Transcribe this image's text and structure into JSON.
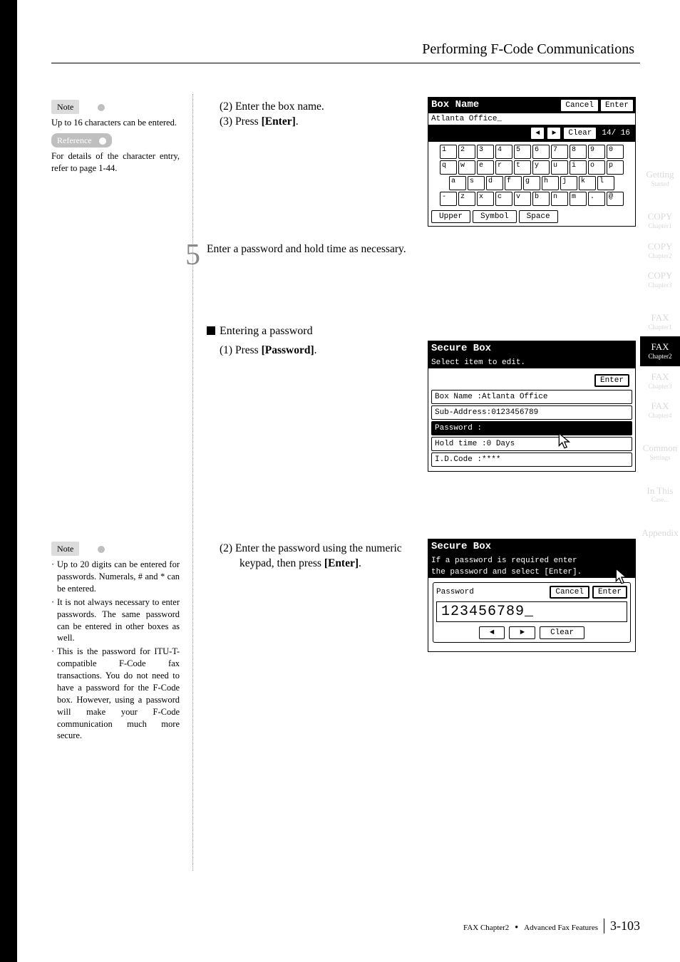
{
  "header": {
    "title": "Performing F-Code Communications"
  },
  "sidebar_note1": {
    "pill": "Note",
    "body": "Up to 16 characters can be entered.",
    "ref_pill": "Reference",
    "ref_body": "For details of the character entry, refer to page 1-44."
  },
  "sidebar_note2": {
    "pill": "Note",
    "b1": "Up to 20 digits can be entered for passwords. Numerals, # and * can be entered.",
    "b2": "It is not always necessary to enter passwords. The same password can be entered in other boxes as well.",
    "b3": "This is the password for ITU-T-compatible F-Code fax transactions. You do not need to have a password for the F-Code box. However, using a password will make your F-Code communication much more secure."
  },
  "main": {
    "m1a": "(2) Enter the box name.",
    "m1b_pre": "(3) Press ",
    "m1b_bold": "[Enter]",
    "m1b_post": ".",
    "step5_num": "5",
    "step5_text": "Enter a password and hold time as necessary.",
    "m3_head": "Entering a password",
    "m3a_pre": "(1) Press ",
    "m3a_bold": "[Password]",
    "m3a_post": ".",
    "m4a": "(2) Enter the password using the numeric keypad, then press ",
    "m4a_bold": "[Enter]",
    "m4a_post": "."
  },
  "panel_kbd": {
    "title": "Box Name",
    "cancel": "Cancel",
    "enter": "Enter",
    "display": "Atlanta Office_",
    "clear": "Clear",
    "counter": "14/ 16",
    "row1": [
      "1",
      "2",
      "3",
      "4",
      "5",
      "6",
      "7",
      "8",
      "9",
      "0"
    ],
    "row2": [
      "q",
      "w",
      "e",
      "r",
      "t",
      "y",
      "u",
      "i",
      "o",
      "p"
    ],
    "row3": [
      "a",
      "s",
      "d",
      "f",
      "g",
      "h",
      "j",
      "k",
      "l"
    ],
    "row4": [
      "-",
      "z",
      "x",
      "c",
      "v",
      "b",
      "n",
      "m",
      ".",
      "@"
    ],
    "upper": "Upper",
    "symbol": "Symbol",
    "space": "Space"
  },
  "panel_list": {
    "title": "Secure Box",
    "subtitle": "Select item to edit.",
    "enter": "Enter",
    "r1": "Box Name  :Atlanta Office",
    "r2": "Sub-Address:0123456789",
    "r3": "Password  :",
    "r4": "Hold time :0 Days",
    "r5": "I.D.Code  :****"
  },
  "panel_pw": {
    "title": "Secure Box",
    "sub1": "If a password is required enter",
    "sub2": "the password and select [Enter].",
    "label": "Password",
    "cancel": "Cancel",
    "enter": "Enter",
    "display": "123456789_",
    "clear": "Clear"
  },
  "tabs": {
    "t1": "Getting",
    "t1s": "Started",
    "t2": "COPY",
    "t2s": "Chapter1",
    "t3": "COPY",
    "t3s": "Chapter2",
    "t4": "COPY",
    "t4s": "Chapter3",
    "t5": "FAX",
    "t5s": "Chapter1",
    "t6": "FAX",
    "t6s": "Chapter2",
    "t7": "FAX",
    "t7s": "Chapter3",
    "t8": "FAX",
    "t8s": "Chapter4",
    "t9": "Common",
    "t9s": "Settings",
    "t10": "In This",
    "t10s": "Case...",
    "t11": "Appendix"
  },
  "footer": {
    "chapter": "FAX Chapter2",
    "dot": "●",
    "section": "Advanced Fax Features",
    "page": "3-103"
  },
  "icons": {
    "left": "◄",
    "right": "►"
  }
}
